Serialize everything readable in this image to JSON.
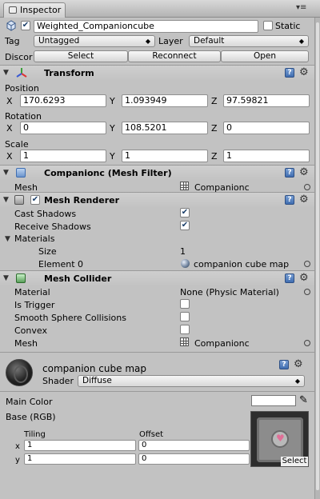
{
  "window": {
    "tab_label": "Inspector",
    "controls_label": "≡"
  },
  "object": {
    "enabled": true,
    "name": "Weighted_Companioncube",
    "static_label": "Static",
    "static_checked": false,
    "tag_label": "Tag",
    "tag_value": "Untagged",
    "layer_label": "Layer",
    "layer_value": "Default",
    "prefab_label": "Discor",
    "prefab_buttons": [
      "Select",
      "Reconnect",
      "Open"
    ]
  },
  "transform": {
    "title": "Transform",
    "position_label": "Position",
    "position": {
      "x": "170.6293",
      "y": "1.093949",
      "z": "97.59821"
    },
    "rotation_label": "Rotation",
    "rotation": {
      "x": "0",
      "y": "108.5201",
      "z": "0"
    },
    "scale_label": "Scale",
    "scale": {
      "x": "1",
      "y": "1",
      "z": "1"
    },
    "axis_labels": [
      "X",
      "Y",
      "Z"
    ]
  },
  "mesh_filter": {
    "title": "Companionc (Mesh Filter)",
    "mesh_label": "Mesh",
    "mesh_value": "Companionc"
  },
  "mesh_renderer": {
    "title": "Mesh Renderer",
    "enabled": true,
    "cast_shadows_label": "Cast Shadows",
    "cast_shadows": true,
    "receive_shadows_label": "Receive Shadows",
    "receive_shadows": true,
    "materials_label": "Materials",
    "size_label": "Size",
    "size_value": "1",
    "element0_label": "Element 0",
    "element0_value": "companion cube map"
  },
  "mesh_collider": {
    "title": "Mesh Collider",
    "material_label": "Material",
    "material_value": "None (Physic Material)",
    "is_trigger_label": "Is Trigger",
    "smooth_label": "Smooth Sphere Collisions",
    "convex_label": "Convex",
    "mesh_label": "Mesh",
    "mesh_value": "Companionc"
  },
  "material": {
    "name": "companion cube map",
    "shader_label": "Shader",
    "shader_value": "Diffuse",
    "main_color_label": "Main Color",
    "main_color": "#ffffff",
    "base_label": "Base (RGB)",
    "tiling_label": "Tiling",
    "offset_label": "Offset",
    "row_x": "x",
    "row_y": "y",
    "tiling_x": "1",
    "tiling_y": "1",
    "offset_x": "0",
    "offset_y": "0",
    "select_label": "Select"
  },
  "icons": {
    "help": "?",
    "gear": "⚙",
    "check": "✔",
    "fold_open": "▼",
    "fold_closed": "▶",
    "dropdown": "◆",
    "eyedropper": "✎"
  }
}
